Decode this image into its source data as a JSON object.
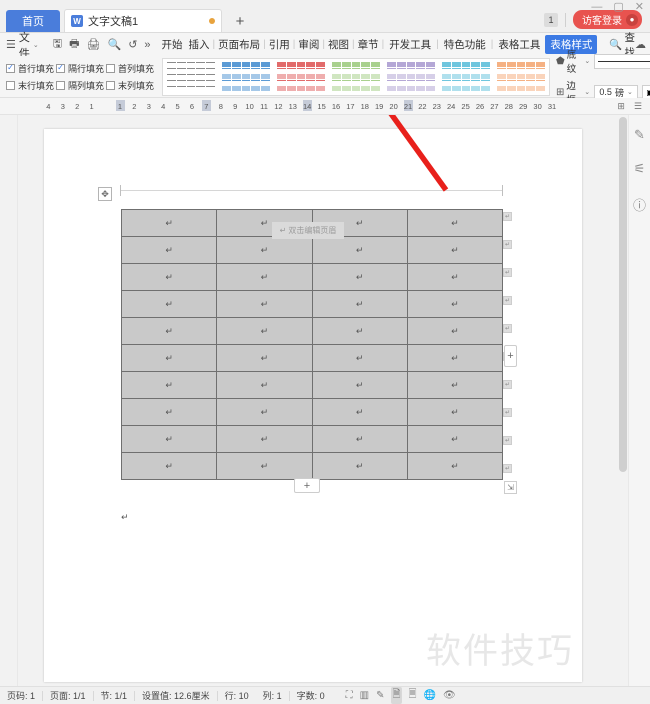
{
  "window": {
    "minimize": "—",
    "maximize": "▢",
    "close": "✕",
    "count_badge": "1",
    "login_label": "访客登录",
    "avatar_icon": "user-icon"
  },
  "tabstrip": {
    "home_tab": "首页",
    "document_tab": "文字文稿1",
    "doc_icon": "W",
    "new_tab": "+"
  },
  "ribbon": {
    "file_menu": "文件",
    "hamburger_icon": "☰",
    "caret_icon": "⌄",
    "quick_access": [
      {
        "name": "save-icon",
        "glyph": "🖫"
      },
      {
        "name": "print-preview-icon",
        "glyph": "🖶"
      },
      {
        "name": "print-icon",
        "glyph": "🖨"
      },
      {
        "name": "preview-icon",
        "glyph": "🔍"
      },
      {
        "name": "undo-icon",
        "glyph": "↺"
      },
      {
        "name": "more-icon",
        "glyph": "»"
      }
    ],
    "tabs": [
      {
        "label": "开始",
        "active": false
      },
      {
        "label": "插入",
        "active": false
      },
      {
        "label": "页面布局",
        "active": false
      },
      {
        "label": "引用",
        "active": false
      },
      {
        "label": "审阅",
        "active": false
      },
      {
        "label": "视图",
        "active": false
      },
      {
        "label": "章节",
        "active": false
      },
      {
        "label": "开发工具",
        "active": false
      },
      {
        "label": "特色功能",
        "active": false
      },
      {
        "label": "表格工具",
        "active": false
      },
      {
        "label": "表格样式",
        "active": true
      }
    ],
    "find_label": "查找",
    "find_icon": "search-icon",
    "right_icons": [
      {
        "name": "cloud-sync-icon",
        "glyph": "☁"
      },
      {
        "name": "share-user-icon",
        "glyph": "👤"
      },
      {
        "name": "upload-share-icon",
        "glyph": "⤴"
      },
      {
        "name": "more-options-icon",
        "glyph": "⋮"
      },
      {
        "name": "collapse-ribbon-icon",
        "glyph": "⌃"
      }
    ]
  },
  "table_style_panel": {
    "checkboxes": [
      {
        "label": "首行填充",
        "checked": true
      },
      {
        "label": "隔行填充",
        "checked": true
      },
      {
        "label": "首列填充",
        "checked": false
      },
      {
        "label": "末行填充",
        "checked": false
      },
      {
        "label": "隔列填充",
        "checked": false
      },
      {
        "label": "末列填充",
        "checked": false
      }
    ],
    "gallery": [
      {
        "name": "style-plain",
        "color": "#ffffff",
        "border": "#9a9a9a"
      },
      {
        "name": "style-blue",
        "color": "#5b9bd5",
        "border": "#5b9bd5"
      },
      {
        "name": "style-red",
        "color": "#e26b6b",
        "border": "#e26b6b"
      },
      {
        "name": "style-green",
        "color": "#a9d18e",
        "border": "#a9d18e"
      },
      {
        "name": "style-purple",
        "color": "#b4a7d6",
        "border": "#b4a7d6"
      },
      {
        "name": "style-cyan",
        "color": "#6fc6de",
        "border": "#6fc6de"
      },
      {
        "name": "style-orange",
        "color": "#f5b183",
        "border": "#f5b183"
      }
    ],
    "shading_label": "底纹",
    "shading_icon": "shading-icon",
    "border_label": "边框",
    "border_icon": "border-icon",
    "line_style_value": "————",
    "line_width_value": "0.5",
    "line_width_unit": "磅",
    "pen_color_icon": "pen-color-icon",
    "draw_table_icon": "draw-table-icon",
    "eraser_icon": "eraser-icon"
  },
  "ruler": {
    "left_marks": [
      "4",
      "3",
      "2",
      "1"
    ],
    "marks": [
      "1",
      "2",
      "3",
      "4",
      "5",
      "6",
      "7",
      "8",
      "9",
      "10",
      "11",
      "12",
      "13",
      "14",
      "15",
      "16",
      "17",
      "18",
      "19",
      "20",
      "21",
      "22",
      "23",
      "24",
      "25",
      "26",
      "27",
      "28",
      "29",
      "30",
      "31"
    ],
    "end_icons": [
      {
        "name": "ruler-toggle-icon",
        "glyph": "⊞"
      },
      {
        "name": "ruler-menu-icon",
        "glyph": "☰"
      }
    ]
  },
  "document": {
    "watermark": "软件技巧",
    "header_tooltip": "双击编辑页眉",
    "header_tooltip_icon": "pilcrow-icon",
    "pilcrow": "↵",
    "move_handle_icon": "move-handle-icon",
    "add_row_label": "+",
    "add_column_label": "+",
    "resize_handle_icon": "resize-handle-icon",
    "table": {
      "rows": 10,
      "columns": 4,
      "cells": [
        [
          "↵",
          "↵",
          "↵",
          "↵"
        ],
        [
          "↵",
          "↵",
          "↵",
          "↵"
        ],
        [
          "↵",
          "↵",
          "↵",
          "↵"
        ],
        [
          "↵",
          "↵",
          "↵",
          "↵"
        ],
        [
          "↵",
          "↵",
          "↵",
          "↵"
        ],
        [
          "↵",
          "↵",
          "↵",
          "↵"
        ],
        [
          "↵",
          "↵",
          "↵",
          "↵"
        ],
        [
          "↵",
          "↵",
          "↵",
          "↵"
        ],
        [
          "↵",
          "↵",
          "↵",
          "↵"
        ],
        [
          "↵",
          "↵",
          "↵",
          "↵"
        ]
      ],
      "cell_fill": "#c9c9c9",
      "cell_border": "#6f6f6f"
    },
    "trailing_paragraph": "↵"
  },
  "right_rail": [
    {
      "name": "edit-pen-icon",
      "glyph": "✎"
    },
    {
      "name": "settings-sliders-icon",
      "glyph": "⚟"
    },
    {
      "name": "help-icon",
      "glyph": "?"
    }
  ],
  "annotation": {
    "arrow_color": "#e8201b",
    "arrow_name": "red-pointer-arrow"
  },
  "statusbar": {
    "items": [
      "页码: 1",
      "页面: 1/1",
      "节: 1/1",
      "设置值: 12.6厘米",
      "行: 10",
      "列: 1",
      "字数: 0"
    ],
    "view_icons": [
      {
        "name": "fullscreen-icon",
        "glyph": "⛶",
        "active": false
      },
      {
        "name": "two-page-view-icon",
        "glyph": "▥",
        "active": false
      },
      {
        "name": "annotate-icon",
        "glyph": "✎",
        "active": false
      },
      {
        "name": "print-layout-view-icon",
        "glyph": "🗎",
        "active": true
      },
      {
        "name": "reading-layout-view-icon",
        "glyph": "🗏",
        "active": false
      },
      {
        "name": "web-layout-view-icon",
        "glyph": "🌐",
        "active": false
      },
      {
        "name": "eye-protection-icon",
        "glyph": "👁",
        "active": false
      }
    ]
  }
}
